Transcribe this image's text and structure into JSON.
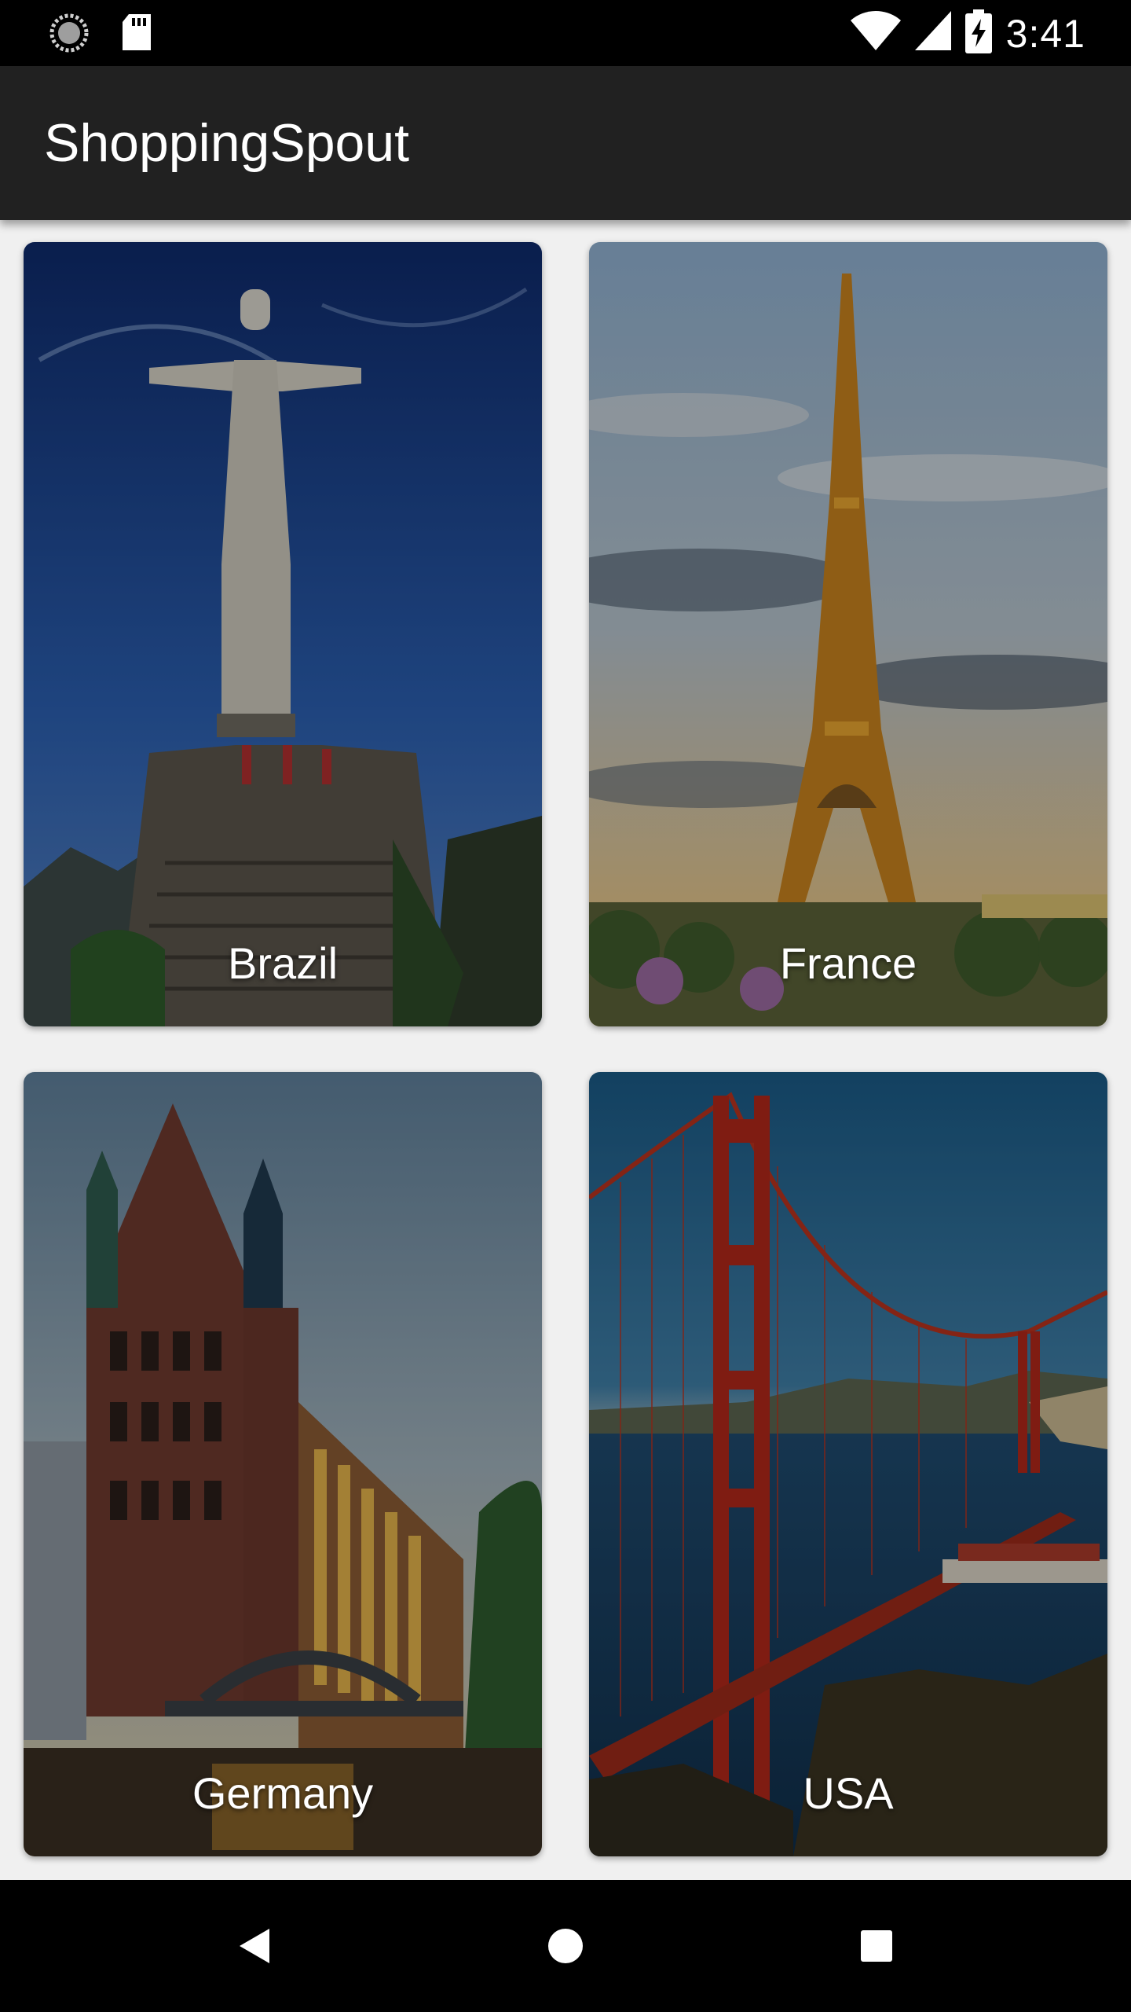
{
  "status_bar": {
    "time": "3:41",
    "icons": [
      "sync-icon",
      "sd-card-icon",
      "wifi-icon",
      "signal-icon",
      "battery-charging-icon"
    ]
  },
  "app_bar": {
    "title": "ShoppingSpout"
  },
  "countries": [
    {
      "name": "Brazil",
      "image": "christ-the-redeemer-image"
    },
    {
      "name": "France",
      "image": "eiffel-tower-image"
    },
    {
      "name": "Germany",
      "image": "hamburg-speicherstadt-image"
    },
    {
      "name": "USA",
      "image": "golden-gate-bridge-image"
    }
  ],
  "nav_bar": {
    "icons": [
      "back-icon",
      "home-icon",
      "recents-icon"
    ]
  },
  "colors": {
    "app_bar": "#212121",
    "background": "#f0f0f0",
    "status_bar": "#000000"
  }
}
